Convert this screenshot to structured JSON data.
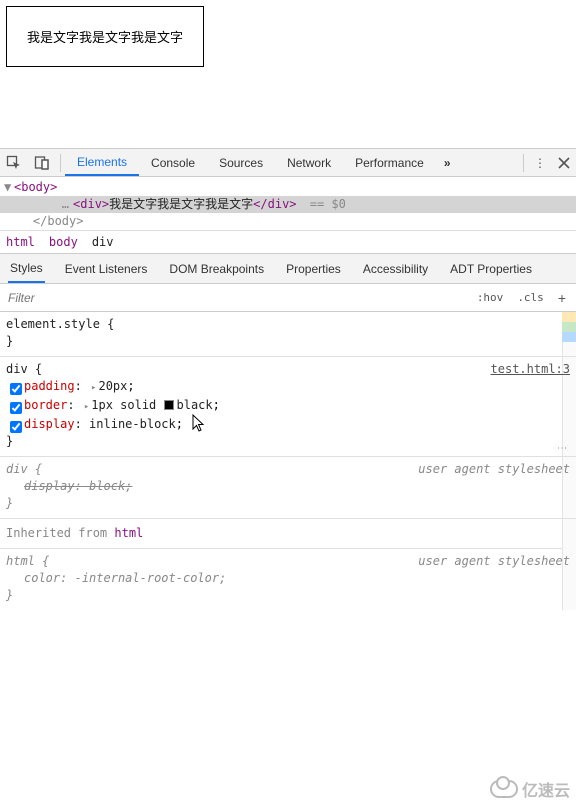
{
  "page": {
    "demo_text": "我是文字我是文字我是文字"
  },
  "toolbar": {
    "tabs": [
      "Elements",
      "Console",
      "Sources",
      "Network",
      "Performance"
    ],
    "active_tab_index": 0,
    "overflow_glyph": "»"
  },
  "dom": {
    "line1_tri": "▼",
    "line1_open": "<body>",
    "sel_indent": "        ",
    "sel_dots": "…",
    "sel_open": "<div>",
    "sel_text": "我是文字我是文字我是文字",
    "sel_close": "</div>",
    "sel_eq": " == $0",
    "line3": "    </body>"
  },
  "crumbs": [
    "html",
    "body",
    "div"
  ],
  "sub_tabs": [
    "Styles",
    "Event Listeners",
    "DOM Breakpoints",
    "Properties",
    "Accessibility",
    "ADT Properties"
  ],
  "filter": {
    "placeholder": "Filter",
    "hov": ":hov",
    "cls": ".cls",
    "plus": "+"
  },
  "styles": {
    "element_style": {
      "selector": "element.style",
      "open": " {",
      "close": "}"
    },
    "div_rule": {
      "selector": "div",
      "open": " {",
      "src": "test.html:3",
      "props": [
        {
          "name": "padding",
          "pre_val_tri": "▸",
          "value": "20px",
          "swatch": false
        },
        {
          "name": "border",
          "pre_val_tri": "▸",
          "value_prefix": "1px solid ",
          "value_suffix": "black",
          "swatch": true
        },
        {
          "name": "display",
          "pre_val_tri": "",
          "value": "inline-block",
          "swatch": false
        }
      ],
      "close": "}"
    },
    "ua_div": {
      "selector": "div",
      "open": " {",
      "label": "user agent stylesheet",
      "prop_name": "display",
      "prop_value": "block",
      "close": "}"
    },
    "inherited_label": "Inherited from ",
    "inherited_from": "html",
    "ua_html": {
      "selector": "html",
      "open": " {",
      "label": "user agent stylesheet",
      "prop_name": "color",
      "prop_value": "-internal-root-color",
      "close": "}"
    }
  },
  "punct": {
    "colon": ":",
    "semi": ";"
  },
  "watermark": "亿速云"
}
